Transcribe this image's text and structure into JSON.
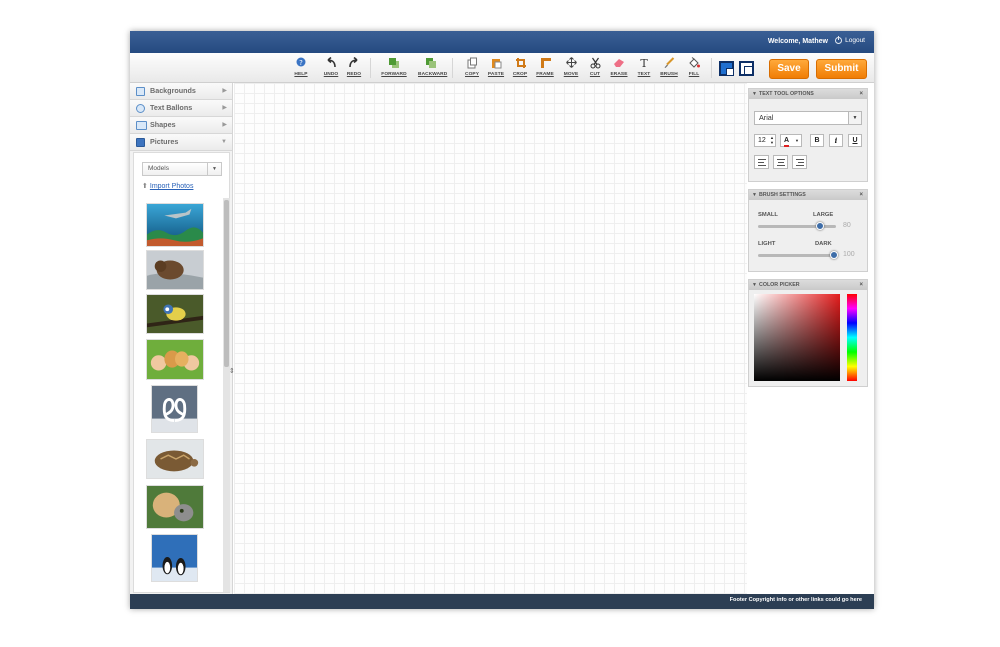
{
  "header": {
    "welcome": "Welcome, Mathew",
    "logout": "Logout"
  },
  "toolbar": {
    "tools": {
      "help": "HELP",
      "undo": "UNDO",
      "redo": "REDO",
      "forward": "FORWARD",
      "backward": "BACKWARD",
      "copy": "COPY",
      "paste": "PASTE",
      "crop": "CROP",
      "frame": "FRAME",
      "move": "MOVE",
      "cut": "CUT",
      "erase": "ERASE",
      "text": "TEXT",
      "brush": "BRUSH",
      "fill": "FILL"
    },
    "foreground_color": "#1f6fd0",
    "background_color": "#ffffff",
    "save": "Save",
    "submit": "Submit",
    "accent_color": "#f7931e"
  },
  "sidebar": {
    "items": [
      "Backgrounds",
      "Text Ballons",
      "Shapes",
      "Pictures"
    ],
    "pictures": {
      "category": "Models",
      "import_link": "Import Photos",
      "thumbnails": [
        "shark-photo",
        "bear-photo",
        "bird-photo",
        "puppies-children-photo",
        "swans-photo",
        "tortoise-photo",
        "dog-cat-photo",
        "penguins-photo"
      ]
    }
  },
  "text_tool": {
    "title": "TEXT TOOL OPTIONS",
    "font": "Arial",
    "size": "12",
    "color_label": "A",
    "bold": "B",
    "italic": "i",
    "underline": "U"
  },
  "brush": {
    "title": "BRUSH SETTINGS",
    "size_min": "SMALL",
    "size_max": "LARGE",
    "size_value": "80",
    "opacity_min": "LIGHT",
    "opacity_max": "DARK",
    "opacity_value": "100"
  },
  "color_picker": {
    "title": "COLOR PICKER",
    "hue": "#e41d1d"
  },
  "footer": {
    "text": "Footer Copyright info or other links could go here"
  }
}
